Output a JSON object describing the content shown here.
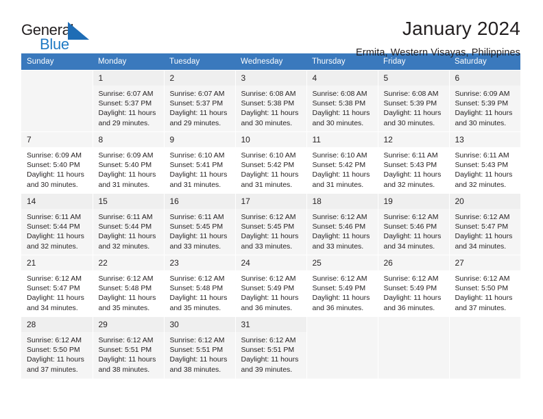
{
  "brand": {
    "name_top": "General",
    "name_bottom": "Blue",
    "triangle_color": "#1f6db5",
    "blue_color": "#1f7ac4"
  },
  "header": {
    "title": "January 2024",
    "subtitle": "Ermita, Western Visayas, Philippines"
  },
  "theme": {
    "header_row_bg": "#3a79bd",
    "header_row_text": "#ffffff",
    "shaded_row_bg": "#f5f5f5",
    "daynum_bg": "#efefef",
    "text": "#231f20"
  },
  "weekday_headers": [
    "Sunday",
    "Monday",
    "Tuesday",
    "Wednesday",
    "Thursday",
    "Friday",
    "Saturday"
  ],
  "weeks": [
    {
      "shaded": true,
      "days": [
        {
          "empty": true
        },
        {
          "day": "1",
          "sunrise": "Sunrise: 6:07 AM",
          "sunset": "Sunset: 5:37 PM",
          "daylight_line1": "Daylight: 11 hours",
          "daylight_line2": "and 29 minutes."
        },
        {
          "day": "2",
          "sunrise": "Sunrise: 6:07 AM",
          "sunset": "Sunset: 5:37 PM",
          "daylight_line1": "Daylight: 11 hours",
          "daylight_line2": "and 29 minutes."
        },
        {
          "day": "3",
          "sunrise": "Sunrise: 6:08 AM",
          "sunset": "Sunset: 5:38 PM",
          "daylight_line1": "Daylight: 11 hours",
          "daylight_line2": "and 30 minutes."
        },
        {
          "day": "4",
          "sunrise": "Sunrise: 6:08 AM",
          "sunset": "Sunset: 5:38 PM",
          "daylight_line1": "Daylight: 11 hours",
          "daylight_line2": "and 30 minutes."
        },
        {
          "day": "5",
          "sunrise": "Sunrise: 6:08 AM",
          "sunset": "Sunset: 5:39 PM",
          "daylight_line1": "Daylight: 11 hours",
          "daylight_line2": "and 30 minutes."
        },
        {
          "day": "6",
          "sunrise": "Sunrise: 6:09 AM",
          "sunset": "Sunset: 5:39 PM",
          "daylight_line1": "Daylight: 11 hours",
          "daylight_line2": "and 30 minutes."
        }
      ]
    },
    {
      "shaded": false,
      "days": [
        {
          "day": "7",
          "sunrise": "Sunrise: 6:09 AM",
          "sunset": "Sunset: 5:40 PM",
          "daylight_line1": "Daylight: 11 hours",
          "daylight_line2": "and 30 minutes."
        },
        {
          "day": "8",
          "sunrise": "Sunrise: 6:09 AM",
          "sunset": "Sunset: 5:40 PM",
          "daylight_line1": "Daylight: 11 hours",
          "daylight_line2": "and 31 minutes."
        },
        {
          "day": "9",
          "sunrise": "Sunrise: 6:10 AM",
          "sunset": "Sunset: 5:41 PM",
          "daylight_line1": "Daylight: 11 hours",
          "daylight_line2": "and 31 minutes."
        },
        {
          "day": "10",
          "sunrise": "Sunrise: 6:10 AM",
          "sunset": "Sunset: 5:42 PM",
          "daylight_line1": "Daylight: 11 hours",
          "daylight_line2": "and 31 minutes."
        },
        {
          "day": "11",
          "sunrise": "Sunrise: 6:10 AM",
          "sunset": "Sunset: 5:42 PM",
          "daylight_line1": "Daylight: 11 hours",
          "daylight_line2": "and 31 minutes."
        },
        {
          "day": "12",
          "sunrise": "Sunrise: 6:11 AM",
          "sunset": "Sunset: 5:43 PM",
          "daylight_line1": "Daylight: 11 hours",
          "daylight_line2": "and 32 minutes."
        },
        {
          "day": "13",
          "sunrise": "Sunrise: 6:11 AM",
          "sunset": "Sunset: 5:43 PM",
          "daylight_line1": "Daylight: 11 hours",
          "daylight_line2": "and 32 minutes."
        }
      ]
    },
    {
      "shaded": true,
      "days": [
        {
          "day": "14",
          "sunrise": "Sunrise: 6:11 AM",
          "sunset": "Sunset: 5:44 PM",
          "daylight_line1": "Daylight: 11 hours",
          "daylight_line2": "and 32 minutes."
        },
        {
          "day": "15",
          "sunrise": "Sunrise: 6:11 AM",
          "sunset": "Sunset: 5:44 PM",
          "daylight_line1": "Daylight: 11 hours",
          "daylight_line2": "and 32 minutes."
        },
        {
          "day": "16",
          "sunrise": "Sunrise: 6:11 AM",
          "sunset": "Sunset: 5:45 PM",
          "daylight_line1": "Daylight: 11 hours",
          "daylight_line2": "and 33 minutes."
        },
        {
          "day": "17",
          "sunrise": "Sunrise: 6:12 AM",
          "sunset": "Sunset: 5:45 PM",
          "daylight_line1": "Daylight: 11 hours",
          "daylight_line2": "and 33 minutes."
        },
        {
          "day": "18",
          "sunrise": "Sunrise: 6:12 AM",
          "sunset": "Sunset: 5:46 PM",
          "daylight_line1": "Daylight: 11 hours",
          "daylight_line2": "and 33 minutes."
        },
        {
          "day": "19",
          "sunrise": "Sunrise: 6:12 AM",
          "sunset": "Sunset: 5:46 PM",
          "daylight_line1": "Daylight: 11 hours",
          "daylight_line2": "and 34 minutes."
        },
        {
          "day": "20",
          "sunrise": "Sunrise: 6:12 AM",
          "sunset": "Sunset: 5:47 PM",
          "daylight_line1": "Daylight: 11 hours",
          "daylight_line2": "and 34 minutes."
        }
      ]
    },
    {
      "shaded": false,
      "days": [
        {
          "day": "21",
          "sunrise": "Sunrise: 6:12 AM",
          "sunset": "Sunset: 5:47 PM",
          "daylight_line1": "Daylight: 11 hours",
          "daylight_line2": "and 34 minutes."
        },
        {
          "day": "22",
          "sunrise": "Sunrise: 6:12 AM",
          "sunset": "Sunset: 5:48 PM",
          "daylight_line1": "Daylight: 11 hours",
          "daylight_line2": "and 35 minutes."
        },
        {
          "day": "23",
          "sunrise": "Sunrise: 6:12 AM",
          "sunset": "Sunset: 5:48 PM",
          "daylight_line1": "Daylight: 11 hours",
          "daylight_line2": "and 35 minutes."
        },
        {
          "day": "24",
          "sunrise": "Sunrise: 6:12 AM",
          "sunset": "Sunset: 5:49 PM",
          "daylight_line1": "Daylight: 11 hours",
          "daylight_line2": "and 36 minutes."
        },
        {
          "day": "25",
          "sunrise": "Sunrise: 6:12 AM",
          "sunset": "Sunset: 5:49 PM",
          "daylight_line1": "Daylight: 11 hours",
          "daylight_line2": "and 36 minutes."
        },
        {
          "day": "26",
          "sunrise": "Sunrise: 6:12 AM",
          "sunset": "Sunset: 5:49 PM",
          "daylight_line1": "Daylight: 11 hours",
          "daylight_line2": "and 36 minutes."
        },
        {
          "day": "27",
          "sunrise": "Sunrise: 6:12 AM",
          "sunset": "Sunset: 5:50 PM",
          "daylight_line1": "Daylight: 11 hours",
          "daylight_line2": "and 37 minutes."
        }
      ]
    },
    {
      "shaded": true,
      "days": [
        {
          "day": "28",
          "sunrise": "Sunrise: 6:12 AM",
          "sunset": "Sunset: 5:50 PM",
          "daylight_line1": "Daylight: 11 hours",
          "daylight_line2": "and 37 minutes."
        },
        {
          "day": "29",
          "sunrise": "Sunrise: 6:12 AM",
          "sunset": "Sunset: 5:51 PM",
          "daylight_line1": "Daylight: 11 hours",
          "daylight_line2": "and 38 minutes."
        },
        {
          "day": "30",
          "sunrise": "Sunrise: 6:12 AM",
          "sunset": "Sunset: 5:51 PM",
          "daylight_line1": "Daylight: 11 hours",
          "daylight_line2": "and 38 minutes."
        },
        {
          "day": "31",
          "sunrise": "Sunrise: 6:12 AM",
          "sunset": "Sunset: 5:51 PM",
          "daylight_line1": "Daylight: 11 hours",
          "daylight_line2": "and 39 minutes."
        },
        {
          "empty": true
        },
        {
          "empty": true
        },
        {
          "empty": true
        }
      ]
    }
  ]
}
